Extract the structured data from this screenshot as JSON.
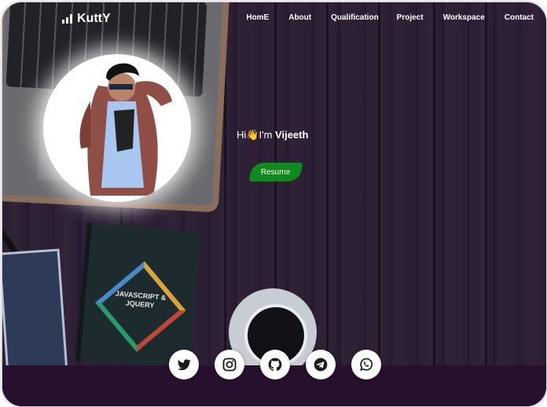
{
  "brand": {
    "name": "KuttY",
    "icon": "signal-bars-icon"
  },
  "nav": {
    "items": [
      "HomE",
      "About",
      "Qualification",
      "Project",
      "Workspace",
      "Contact"
    ]
  },
  "hero": {
    "greeting": "Hi",
    "wave_emoji": "👋",
    "intro": "I'm",
    "name": "Vijeeth",
    "resume_label": "Resume"
  },
  "desk": {
    "book_title": "JAVASCRIPT & JQUERY"
  },
  "social": [
    {
      "name": "twitter-icon",
      "color": "#1a1a1a"
    },
    {
      "name": "instagram-icon",
      "color": "#1a1a1a"
    },
    {
      "name": "github-icon",
      "color": "#1a1a1a"
    },
    {
      "name": "telegram-icon",
      "color": "#1a1a1a"
    },
    {
      "name": "whatsapp-icon",
      "color": "#1a1a1a"
    }
  ],
  "colors": {
    "resume_button": "#0f8a1c",
    "footer": "#26102e",
    "overlay": "#1e123c"
  }
}
